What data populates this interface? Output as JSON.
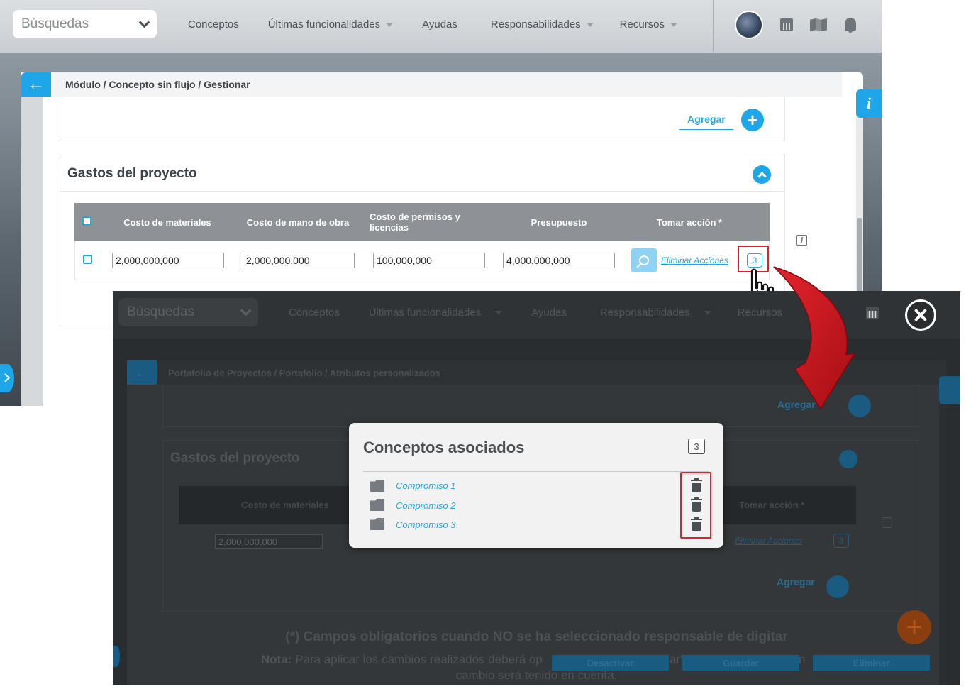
{
  "back": {
    "search": {
      "label": "Búsquedas"
    },
    "nav": [
      {
        "label": "Conceptos",
        "dropdown": false
      },
      {
        "label": "Últimas funcionalidades",
        "dropdown": true
      },
      {
        "label": "Ayudas",
        "dropdown": false
      },
      {
        "label": "Responsabilidades",
        "dropdown": true
      },
      {
        "label": "Recursos",
        "dropdown": true
      }
    ],
    "breadcrumb": "Módulo / Concepto sin flujo / Gestionar",
    "add_label": "Agregar",
    "section_title": "Gastos del proyecto",
    "table": {
      "headers": [
        "Costo de materiales",
        "Costo de mano de obra",
        "Costo de permisos y licencias",
        "Presupuesto",
        "Tomar acción *"
      ],
      "row": {
        "values": [
          "2,000,000,000",
          "2,000,000,000",
          "100,000,000",
          "4,000,000,000"
        ],
        "action_link": "Eliminar Acciones",
        "count": "3"
      }
    },
    "info_label": "i"
  },
  "front": {
    "search": {
      "label": "Búsquedas"
    },
    "nav": [
      {
        "label": "Conceptos"
      },
      {
        "label": "Últimas funcionalidades"
      },
      {
        "label": "Ayudas"
      },
      {
        "label": "Responsabilidades"
      },
      {
        "label": "Recursos"
      }
    ],
    "breadcrumb": "Portafolio de Proyectos / Portafolio / Atributos personalizados",
    "add_label": "Agregar",
    "section_title": "Gastos del proyecto",
    "table": {
      "header_first": "Costo de materiales",
      "header_action": "Tomar acción *",
      "value_first": "2,000,000,000",
      "action_link": "Eliminar Acciones",
      "count": "3"
    },
    "add_label_2": "Agregar",
    "required_note": "(*) Campos obligatorios cuando NO se ha seleccionado responsable de digitar",
    "note_label": "Nota:",
    "note_text": "Para aplicar los cambios realizados deberá op",
    "note_mid": "ar\",",
    "note_end": "n",
    "note_line2": "cambio será tenido en cuenta.",
    "buttons": {
      "deactivate": "Desactivar",
      "save": "Guardar",
      "delete": "Eliminar"
    },
    "modal": {
      "title": "Conceptos asociados",
      "count": "3",
      "items": [
        "Compromiso 1",
        "Compromiso 2",
        "Compromiso 3"
      ]
    }
  },
  "colors": {
    "accent": "#1ea6e8",
    "highlight": "#e0202b",
    "arrow": "#c8141c"
  }
}
